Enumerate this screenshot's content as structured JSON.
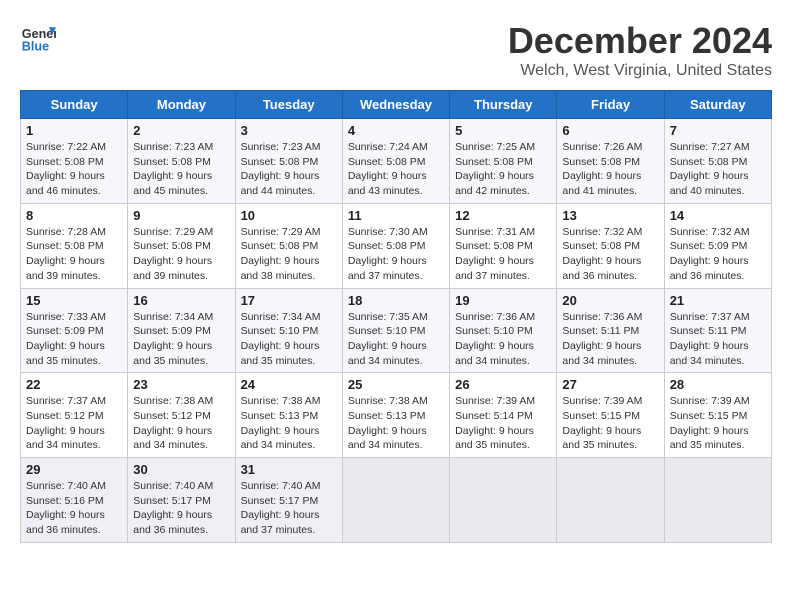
{
  "logo": {
    "text_general": "General",
    "text_blue": "Blue"
  },
  "title": "December 2024",
  "subtitle": "Welch, West Virginia, United States",
  "days_of_week": [
    "Sunday",
    "Monday",
    "Tuesday",
    "Wednesday",
    "Thursday",
    "Friday",
    "Saturday"
  ],
  "weeks": [
    [
      {
        "day": "1",
        "sunrise": "7:22 AM",
        "sunset": "5:08 PM",
        "daylight": "9 hours and 46 minutes."
      },
      {
        "day": "2",
        "sunrise": "7:23 AM",
        "sunset": "5:08 PM",
        "daylight": "9 hours and 45 minutes."
      },
      {
        "day": "3",
        "sunrise": "7:23 AM",
        "sunset": "5:08 PM",
        "daylight": "9 hours and 44 minutes."
      },
      {
        "day": "4",
        "sunrise": "7:24 AM",
        "sunset": "5:08 PM",
        "daylight": "9 hours and 43 minutes."
      },
      {
        "day": "5",
        "sunrise": "7:25 AM",
        "sunset": "5:08 PM",
        "daylight": "9 hours and 42 minutes."
      },
      {
        "day": "6",
        "sunrise": "7:26 AM",
        "sunset": "5:08 PM",
        "daylight": "9 hours and 41 minutes."
      },
      {
        "day": "7",
        "sunrise": "7:27 AM",
        "sunset": "5:08 PM",
        "daylight": "9 hours and 40 minutes."
      }
    ],
    [
      {
        "day": "8",
        "sunrise": "7:28 AM",
        "sunset": "5:08 PM",
        "daylight": "9 hours and 39 minutes."
      },
      {
        "day": "9",
        "sunrise": "7:29 AM",
        "sunset": "5:08 PM",
        "daylight": "9 hours and 39 minutes."
      },
      {
        "day": "10",
        "sunrise": "7:29 AM",
        "sunset": "5:08 PM",
        "daylight": "9 hours and 38 minutes."
      },
      {
        "day": "11",
        "sunrise": "7:30 AM",
        "sunset": "5:08 PM",
        "daylight": "9 hours and 37 minutes."
      },
      {
        "day": "12",
        "sunrise": "7:31 AM",
        "sunset": "5:08 PM",
        "daylight": "9 hours and 37 minutes."
      },
      {
        "day": "13",
        "sunrise": "7:32 AM",
        "sunset": "5:08 PM",
        "daylight": "9 hours and 36 minutes."
      },
      {
        "day": "14",
        "sunrise": "7:32 AM",
        "sunset": "5:09 PM",
        "daylight": "9 hours and 36 minutes."
      }
    ],
    [
      {
        "day": "15",
        "sunrise": "7:33 AM",
        "sunset": "5:09 PM",
        "daylight": "9 hours and 35 minutes."
      },
      {
        "day": "16",
        "sunrise": "7:34 AM",
        "sunset": "5:09 PM",
        "daylight": "9 hours and 35 minutes."
      },
      {
        "day": "17",
        "sunrise": "7:34 AM",
        "sunset": "5:10 PM",
        "daylight": "9 hours and 35 minutes."
      },
      {
        "day": "18",
        "sunrise": "7:35 AM",
        "sunset": "5:10 PM",
        "daylight": "9 hours and 34 minutes."
      },
      {
        "day": "19",
        "sunrise": "7:36 AM",
        "sunset": "5:10 PM",
        "daylight": "9 hours and 34 minutes."
      },
      {
        "day": "20",
        "sunrise": "7:36 AM",
        "sunset": "5:11 PM",
        "daylight": "9 hours and 34 minutes."
      },
      {
        "day": "21",
        "sunrise": "7:37 AM",
        "sunset": "5:11 PM",
        "daylight": "9 hours and 34 minutes."
      }
    ],
    [
      {
        "day": "22",
        "sunrise": "7:37 AM",
        "sunset": "5:12 PM",
        "daylight": "9 hours and 34 minutes."
      },
      {
        "day": "23",
        "sunrise": "7:38 AM",
        "sunset": "5:12 PM",
        "daylight": "9 hours and 34 minutes."
      },
      {
        "day": "24",
        "sunrise": "7:38 AM",
        "sunset": "5:13 PM",
        "daylight": "9 hours and 34 minutes."
      },
      {
        "day": "25",
        "sunrise": "7:38 AM",
        "sunset": "5:13 PM",
        "daylight": "9 hours and 34 minutes."
      },
      {
        "day": "26",
        "sunrise": "7:39 AM",
        "sunset": "5:14 PM",
        "daylight": "9 hours and 35 minutes."
      },
      {
        "day": "27",
        "sunrise": "7:39 AM",
        "sunset": "5:15 PM",
        "daylight": "9 hours and 35 minutes."
      },
      {
        "day": "28",
        "sunrise": "7:39 AM",
        "sunset": "5:15 PM",
        "daylight": "9 hours and 35 minutes."
      }
    ],
    [
      {
        "day": "29",
        "sunrise": "7:40 AM",
        "sunset": "5:16 PM",
        "daylight": "9 hours and 36 minutes."
      },
      {
        "day": "30",
        "sunrise": "7:40 AM",
        "sunset": "5:17 PM",
        "daylight": "9 hours and 36 minutes."
      },
      {
        "day": "31",
        "sunrise": "7:40 AM",
        "sunset": "5:17 PM",
        "daylight": "9 hours and 37 minutes."
      },
      null,
      null,
      null,
      null
    ]
  ],
  "labels": {
    "sunrise": "Sunrise:",
    "sunset": "Sunset:",
    "daylight": "Daylight:"
  }
}
